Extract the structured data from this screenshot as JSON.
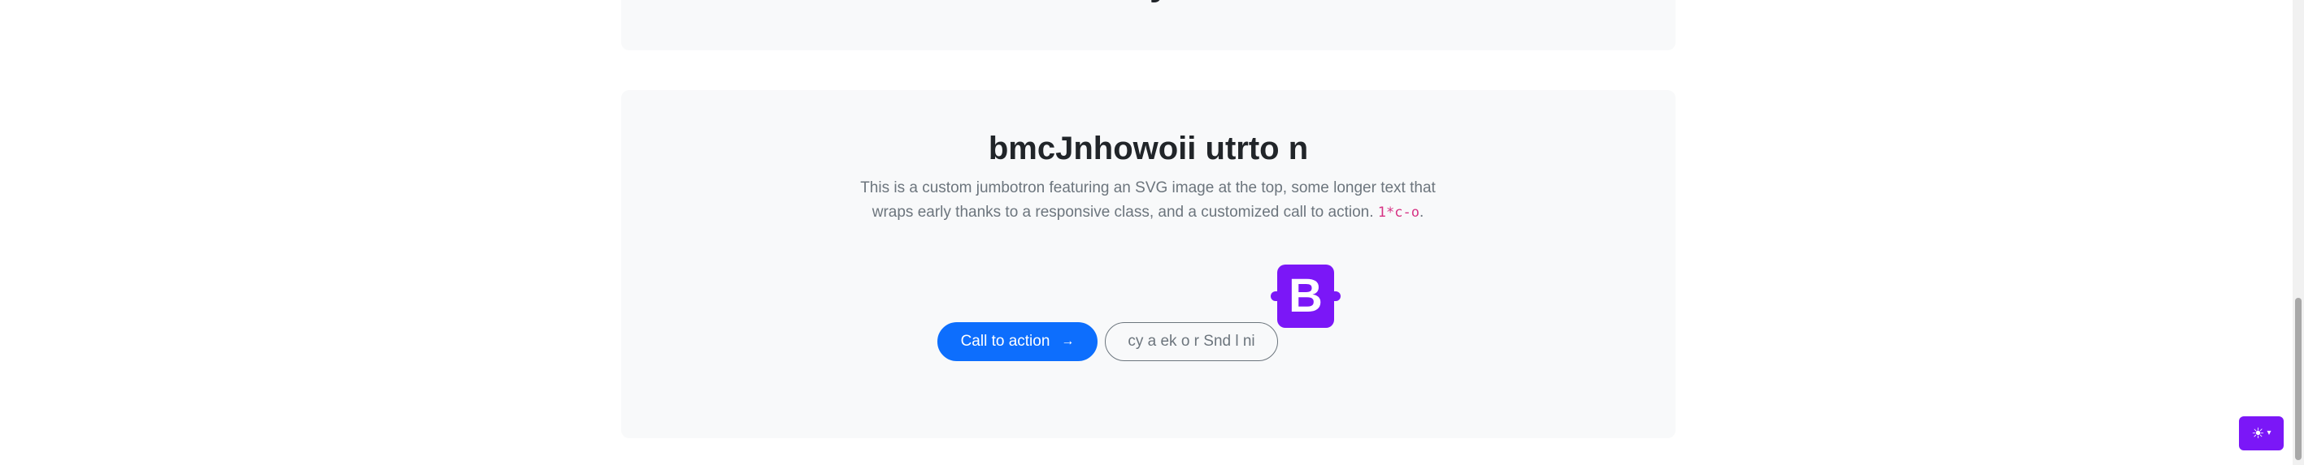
{
  "top_card": {
    "glyph": "y"
  },
  "jumbotron": {
    "title": "bmcJnhowoii utrto n",
    "lead_text": "This is a custom jumbotron featuring an SVG image at the top, some longer text that wraps early thanks to a responsive class, and a customized call to action.",
    "lead_code": "1*c-o",
    "lead_suffix": ".",
    "logo_letter": "B",
    "primary_button_label": "Call to action",
    "primary_button_icon": "→",
    "secondary_button_label": "cy a ek o r Snd l ni"
  },
  "theme_toggle": {
    "icon": "☀",
    "caret": "▾"
  },
  "colors": {
    "accent_purple": "#7b17f7",
    "primary_blue": "#0d6efd",
    "card_bg": "#f8f9fa",
    "code_pink": "#d63384"
  }
}
